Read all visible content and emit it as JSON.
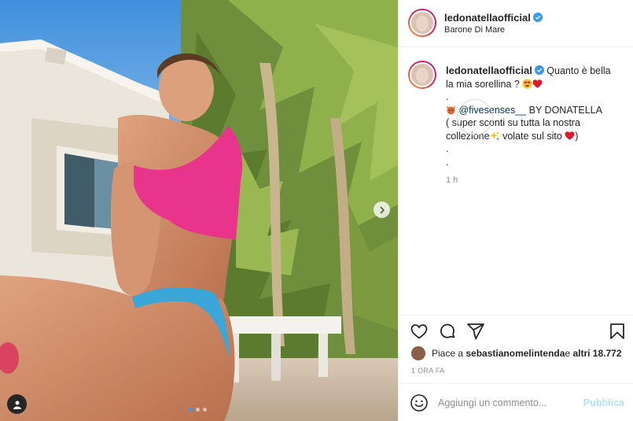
{
  "post": {
    "username": "ledonatellaofficial",
    "location": "Barone Di Mare",
    "caption": {
      "line1_text": "Quanto è bella",
      "line2_text": "la mia sorellina ?",
      "dot1": ".",
      "mention": "@fivesenses__",
      "line3_rest": " BY DONATELLA",
      "line4": "( super sconti su tutta la nostra",
      "line5_a": "collezione",
      "line5_b": " volate sul sito ",
      "line5_c": ")",
      "dot2": ".",
      "dot3": "."
    },
    "caption_age": "1 h",
    "likes": {
      "prefix": "Piace a ",
      "user": "sebastianomelintenda",
      "middle": " e ",
      "others": "altri 18.772"
    },
    "time_ago": "1 ORA FA",
    "comment": {
      "placeholder": "Aggiungi un commento...",
      "publish_label": "Pubblica"
    }
  },
  "colors": {
    "verified": "#3897f0",
    "publish_disabled": "#b2dffc",
    "mention": "#00376b"
  },
  "icons": [
    "verified-badge-icon",
    "heart-eyes-emoji",
    "red-heart-emoji",
    "devil-emoji",
    "sparkles-emoji",
    "chevron-right-icon",
    "user-tag-icon",
    "heart-icon",
    "comment-icon",
    "share-icon",
    "bookmark-icon",
    "smiley-icon"
  ]
}
